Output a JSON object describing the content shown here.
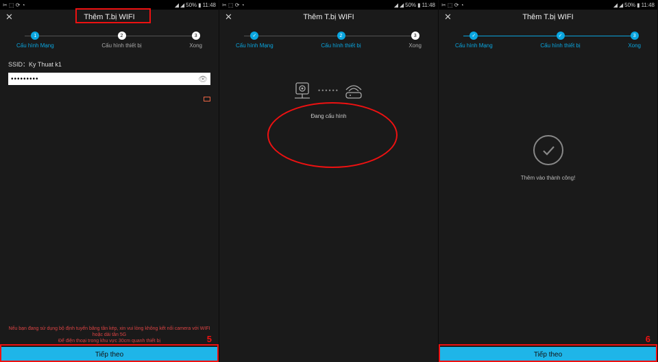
{
  "statusbar": {
    "battery": "50%",
    "time": "11:48"
  },
  "header": {
    "title": "Thêm T.bị WIFI"
  },
  "stepper": {
    "step1": "Cấu hình Mạng",
    "step2": "Cấu hình thiết bị",
    "step3": "Xong"
  },
  "panel1": {
    "ssid_label": "SSID：Ky Thuat k1",
    "password_value": "•••••••••",
    "warn_line1": "Nếu bạn đang sử dụng bộ định tuyến băng tần kép, xin vui lòng không kết nối camera với WIFI hoặc dải tần 5G",
    "warn_line2": "Để điện thoại trong khu vực 30cm quanh thiết bị",
    "button": "Tiếp theo",
    "annotation_number": "5"
  },
  "panel2": {
    "status": "Đang cấu hình"
  },
  "panel3": {
    "success": "Thêm vào thành công!",
    "button": "Tiếp theo",
    "annotation_number": "6"
  }
}
